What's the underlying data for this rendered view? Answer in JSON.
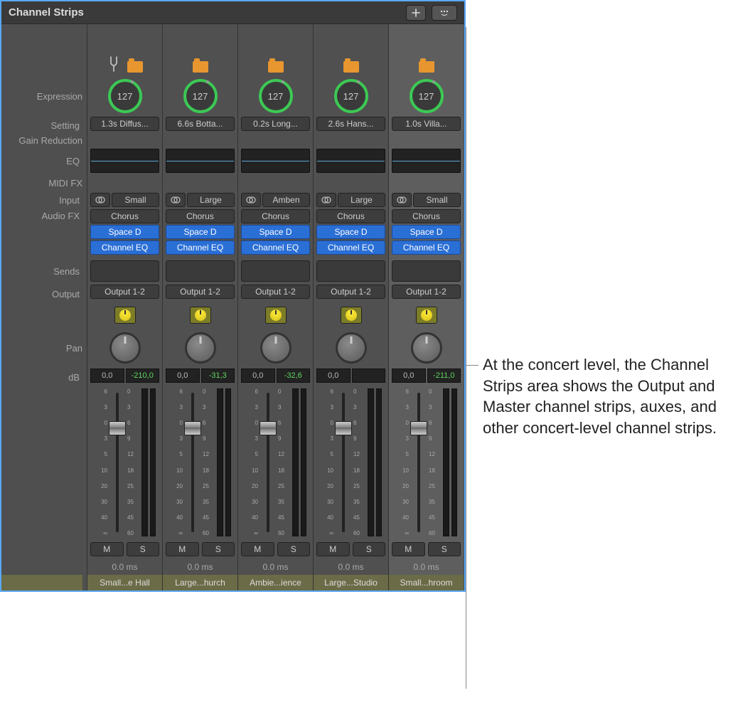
{
  "header": {
    "title": "Channel Strips"
  },
  "labels": {
    "expression": "Expression",
    "setting": "Setting",
    "gain_reduction": "Gain Reduction",
    "eq": "EQ",
    "midi_fx": "MIDI FX",
    "input": "Input",
    "audio_fx": "Audio FX",
    "sends": "Sends",
    "output": "Output",
    "pan": "Pan",
    "db": "dB"
  },
  "common": {
    "mute": "M",
    "solo": "S",
    "chorus": "Chorus",
    "space_d": "Space D",
    "channel_eq": "Channel EQ",
    "output_12": "Output 1-2",
    "delay": "0.0 ms",
    "expr_val": "127"
  },
  "scale_left": [
    "6",
    "3",
    "0",
    "3",
    "5",
    "10",
    "20",
    "30",
    "40",
    "∞"
  ],
  "scale_right": [
    "0",
    "3",
    "6",
    "9",
    "12",
    "18",
    "25",
    "35",
    "45",
    "60"
  ],
  "strips": [
    {
      "tuning": true,
      "setting": "1.3s Diffus...",
      "input": "Small",
      "db_left": "0,0",
      "db_right": "-210,0",
      "name": "Small...e Hall",
      "selected": false
    },
    {
      "tuning": false,
      "setting": "6.6s Botta...",
      "input": "Large",
      "db_left": "0,0",
      "db_right": "-31,3",
      "name": "Large...hurch",
      "selected": false
    },
    {
      "tuning": false,
      "setting": "0.2s Long...",
      "input": "Amben",
      "db_left": "0,0",
      "db_right": "-32,6",
      "name": "Ambie...ience",
      "selected": false
    },
    {
      "tuning": false,
      "setting": "2.6s Hans...",
      "input": "Large",
      "db_left": "0,0",
      "db_right": "",
      "name": "Large...Studio",
      "selected": false
    },
    {
      "tuning": false,
      "setting": "1.0s Villa...",
      "input": "Small",
      "db_left": "0,0",
      "db_right": "-211,0",
      "name": "Small...hroom",
      "selected": true
    }
  ],
  "annotation": "At the concert level, the Channel Strips area shows the Output and Master channel strips, auxes, and other concert-level channel strips."
}
